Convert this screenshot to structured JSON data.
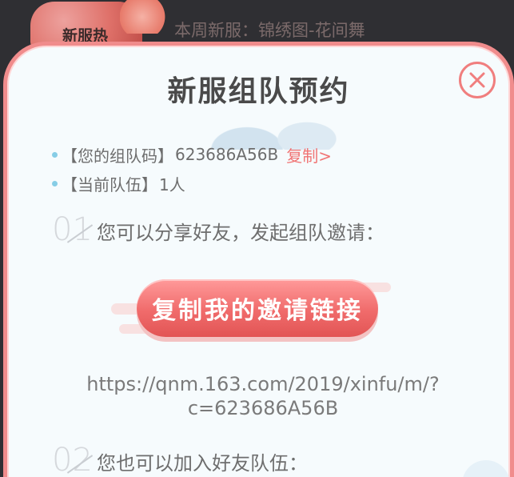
{
  "background": {
    "tag": "新服热",
    "news": "本周新服：锦绣图-花间舞"
  },
  "modal": {
    "title": "新服组队预约",
    "info": [
      {
        "label": "【您的组队码】",
        "value": "623686A56B",
        "action": "复制>"
      },
      {
        "label": "【当前队伍】",
        "value": "1人",
        "action": ""
      }
    ],
    "step1": {
      "num": "01",
      "text": "您可以分享好友，发起组队邀请："
    },
    "invite_button": "复制我的邀请链接",
    "url": "https://qnm.163.com/2019/xinfu/m/?c=623686A56B",
    "step2": {
      "num": "02",
      "text": "您也可以加入好友队伍："
    }
  },
  "colors": {
    "accent": "#f07474",
    "border": "#f08c8c",
    "panel": "#f6fbfd"
  }
}
